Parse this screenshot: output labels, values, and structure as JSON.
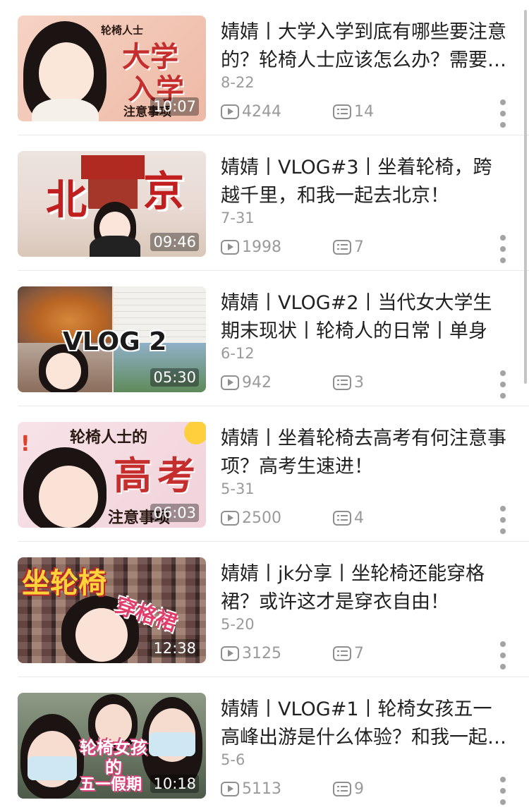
{
  "videos": [
    {
      "title": "婧婧丨大学入学到底有哪些要注意的？轮椅人士应该怎么办？需要准备些什么",
      "date": "8-22",
      "plays": "4244",
      "comments": "14",
      "duration": "10:07",
      "thumb_text": [
        "轮椅人士",
        "大学",
        "入学",
        "注意事项"
      ],
      "thumb_color": "#f4c9b8"
    },
    {
      "title": "婧婧丨VLOG#3丨坐着轮椅，跨越千里，和我一起去北京！",
      "date": "7-31",
      "plays": "1998",
      "comments": "7",
      "duration": "09:46",
      "thumb_text": [
        "北",
        "京"
      ],
      "thumb_color": "#e9dfd8"
    },
    {
      "title": "婧婧丨VLOG#2丨当代女大学生期末现状丨轮椅人的日常丨单身",
      "date": "6-12",
      "plays": "942",
      "comments": "3",
      "duration": "05:30",
      "thumb_text": [
        "VLOG 2"
      ],
      "thumb_color": "#6b5040"
    },
    {
      "title": "婧婧丨坐着轮椅去高考有何注意事项？高考生速进！",
      "date": "5-31",
      "plays": "2500",
      "comments": "4",
      "duration": "06:03",
      "thumb_text": [
        "轮椅人士的",
        "高",
        "考",
        "注意事项"
      ],
      "thumb_color": "#f6dde3"
    },
    {
      "title": "婧婧丨jk分享丨坐轮椅还能穿格裙？或许这才是穿衣自由！",
      "date": "5-20",
      "plays": "3125",
      "comments": "7",
      "duration": "12:38",
      "thumb_text": [
        "坐轮椅",
        "穿格裙"
      ],
      "thumb_color": "#5a3d3a"
    },
    {
      "title": "婧婧丨VLOG#1丨轮椅女孩五一高峰出游是什么体验？和我一起去玩吧",
      "date": "5-6",
      "plays": "5113",
      "comments": "9",
      "duration": "10:18",
      "thumb_text": [
        "轮椅女孩",
        "的",
        "五一假期"
      ],
      "thumb_color": "#7e8a7a"
    }
  ]
}
